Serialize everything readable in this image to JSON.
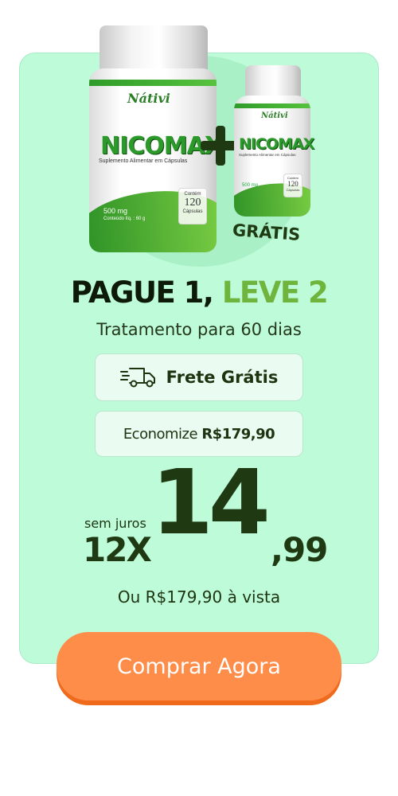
{
  "product": {
    "brand": "Nátivi",
    "name": "NICOMAX",
    "subtitle": "Suplemento Alimentar em Cápsulas",
    "dose": "500 mg",
    "net_content": "Conteúdo líq. : 60 g",
    "capsule_label_top": "Contém",
    "capsule_count": "120",
    "capsule_label_bottom": "Cápsulas",
    "gift_tag": "GRÁTIS"
  },
  "offer": {
    "headline_dark": "PAGUE 1,",
    "headline_light": "LEVE 2",
    "subtitle": "Tratamento para 60 dias",
    "shipping_label": "Frete Grátis",
    "savings_prefix": "Economize",
    "savings_value": "R$179,90"
  },
  "price": {
    "interest_note": "sem juros",
    "installments": "12X",
    "integer": "14",
    "cents": ",99",
    "cash_price": "Ou R$179,90 à vista"
  },
  "cta": {
    "label": "Comprar Agora"
  },
  "colors": {
    "card_bg": "#bdfbd9",
    "accent_green": "#6fb53d",
    "dark_green": "#1f3a12",
    "cta_orange": "#ff8d4a"
  }
}
